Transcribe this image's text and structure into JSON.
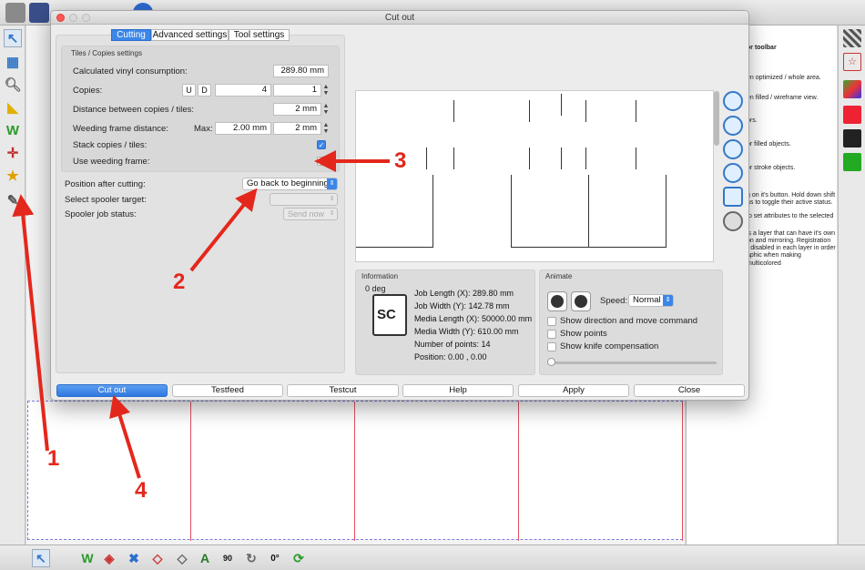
{
  "dialog": {
    "title": "Cut out",
    "tabs": [
      "Cutting",
      "Advanced settings",
      "Tool settings"
    ],
    "tiles_group_title": "Tiles / Copies settings",
    "vinyl_label": "Calculated vinyl consumption:",
    "vinyl_value": "289.80 mm",
    "copies_label": "Copies:",
    "copies_u": "U",
    "copies_d": "D",
    "copies_value": "4",
    "copies_value2": "1",
    "distance_label": "Distance between copies / tiles:",
    "distance_value": "2 mm",
    "weeding_label": "Weeding frame distance:",
    "weeding_max_label": "Max:",
    "weeding_max_value": "2.00 mm",
    "weeding_value": "2 mm",
    "stack_label": "Stack copies / tiles:",
    "stack_checked": true,
    "use_weeding_label": "Use weeding frame:",
    "use_weeding_checked": false,
    "position_label": "Position after cutting:",
    "position_value": "Go back to beginning",
    "spooler_label": "Select spooler target:",
    "spooler_status_label": "Spooler job status:",
    "send_now_label": "Send now",
    "info": {
      "title": "Information",
      "deg_label": "0 deg",
      "logo_text": "SC",
      "rows": [
        "Job Length (X): 289.80 mm",
        "Job Width (Y): 142.78 mm",
        "Media Length (X): 50000.00 mm",
        "Media Width (Y): 610.00 mm",
        "Number of points: 14",
        "Position: 0.00 , 0.00"
      ]
    },
    "animate": {
      "title": "Animate",
      "speed_label": "Speed:",
      "speed_value": "Normal",
      "show_direction": "Show direction and move command",
      "show_points": "Show points",
      "show_knife": "Show knife compensation"
    },
    "buttons": [
      "Cut out",
      "Testfeed",
      "Testcut",
      "Help",
      "Apply",
      "Close"
    ]
  },
  "right_panel": {
    "texts": [
      "or toolbar",
      "en optimized / whole area.",
      "en filled / wireframe view.",
      "ors.",
      "or filled objects.",
      "or stroke objects.",
      "g on it's button. Hold down shift",
      "ns to toggle their active status.",
      "to set attributes to the selected",
      "is a layer that can have it's own",
      "on and mirroring. Registration",
      "r disabled in each layer in order",
      "aphic when making multicolored"
    ]
  },
  "bottom_bar": {
    "labels": [
      "90",
      "0°"
    ]
  },
  "annotations": [
    "1",
    "2",
    "3",
    "4"
  ],
  "colors": {
    "accent": "#3b86e8",
    "annotation": "#e4271c",
    "page_line": "#e05060"
  }
}
